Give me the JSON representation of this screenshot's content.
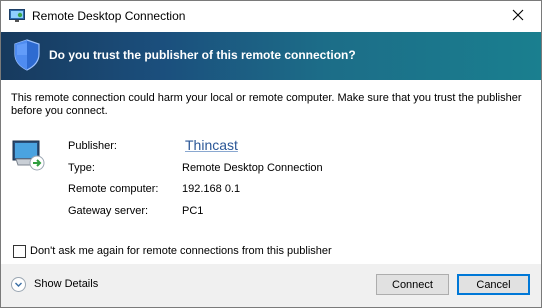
{
  "window": {
    "title": "Remote Desktop Connection",
    "close_glyph": "✕"
  },
  "banner": {
    "text": "Do you trust the publisher of this remote connection?",
    "icon": "shield-icon"
  },
  "warning_text": "This remote connection could harm your local or remote computer. Make sure that you trust the publisher before you connect.",
  "details": {
    "publisher_label": "Publisher:",
    "publisher_value": "Thincast",
    "type_label": "Type:",
    "type_value": "Remote Desktop Connection",
    "remote_computer_label": "Remote computer:",
    "remote_computer_value": "192.168 0.1",
    "gateway_label": "Gateway server:",
    "gateway_value": "PC1"
  },
  "checkbox": {
    "label": "Don't ask me again for remote connections from this publisher",
    "checked": false
  },
  "footer": {
    "show_details_label": "Show Details",
    "connect_label": "Connect",
    "cancel_label": "Cancel"
  },
  "colors": {
    "banner_start": "#173a5e",
    "banner_end": "#1a7f8f",
    "link": "#2b5797",
    "default_button_border": "#0078d7"
  }
}
